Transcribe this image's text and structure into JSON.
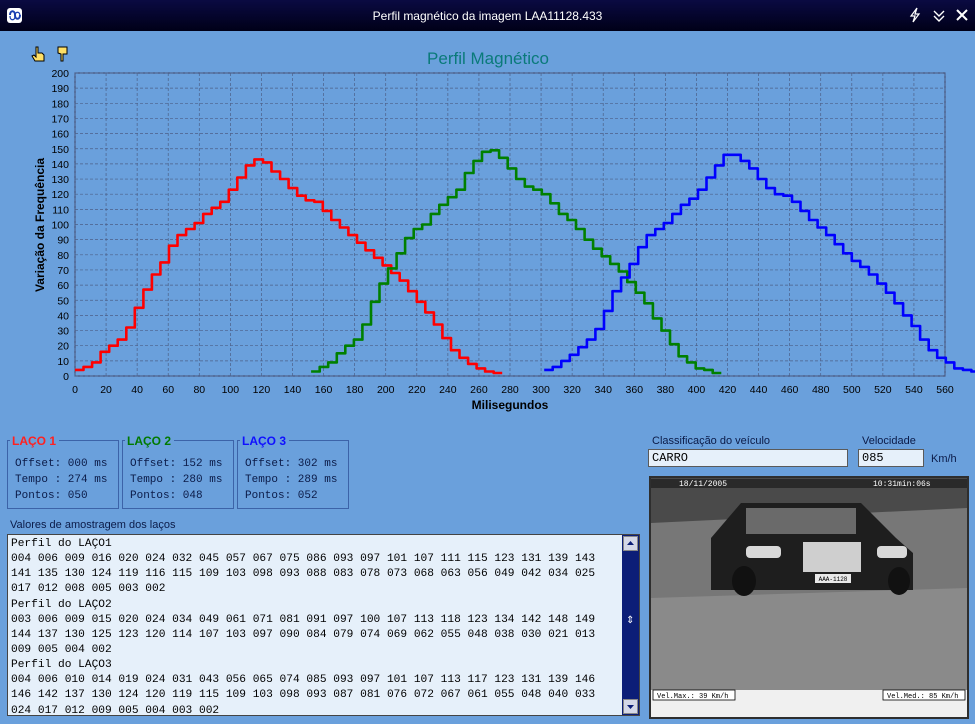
{
  "window": {
    "title": "Perfil magnético da imagem LAA11128.433",
    "controls": [
      "pin-icon",
      "minimize-icon",
      "close-icon"
    ]
  },
  "toolbar": {
    "icons": [
      "hand-pointer-icon",
      "hand-down-icon"
    ]
  },
  "chart_data": {
    "type": "line",
    "title": "Perfil Magnético",
    "xlabel": "Milisegundos",
    "ylabel": "Variação da Frequência",
    "xlim": [
      0,
      560
    ],
    "ylim": [
      0,
      200
    ],
    "xticks": [
      0,
      20,
      40,
      60,
      80,
      100,
      120,
      140,
      160,
      180,
      200,
      220,
      240,
      260,
      280,
      300,
      320,
      340,
      360,
      380,
      400,
      420,
      440,
      460,
      480,
      500,
      520,
      540,
      560
    ],
    "yticks": [
      0,
      10,
      20,
      30,
      40,
      50,
      60,
      70,
      80,
      90,
      100,
      110,
      120,
      130,
      140,
      150,
      160,
      170,
      180,
      190,
      200
    ],
    "grid": true,
    "step_ms": 5.5,
    "series": [
      {
        "color": "#ff0000",
        "x_start": 0,
        "values": [
          4,
          6,
          9,
          16,
          20,
          24,
          32,
          45,
          57,
          67,
          75,
          86,
          93,
          97,
          101,
          107,
          111,
          115,
          123,
          131,
          139,
          143,
          141,
          135,
          130,
          124,
          119,
          116,
          115,
          109,
          103,
          98,
          93,
          88,
          83,
          78,
          73,
          68,
          63,
          56,
          49,
          42,
          34,
          25,
          17,
          12,
          8,
          5,
          3,
          2
        ]
      },
      {
        "color": "#008000",
        "x_start": 152,
        "values": [
          3,
          6,
          9,
          15,
          20,
          24,
          34,
          49,
          61,
          71,
          81,
          91,
          97,
          100,
          107,
          113,
          118,
          123,
          134,
          142,
          148,
          149,
          144,
          137,
          130,
          125,
          123,
          120,
          114,
          107,
          103,
          97,
          90,
          84,
          79,
          74,
          69,
          62,
          55,
          48,
          38,
          30,
          21,
          13,
          9,
          5,
          4,
          2
        ]
      },
      {
        "color": "#0000ff",
        "x_start": 302,
        "values": [
          4,
          6,
          10,
          14,
          19,
          24,
          31,
          43,
          56,
          65,
          74,
          85,
          93,
          97,
          101,
          107,
          113,
          117,
          123,
          131,
          139,
          146,
          146,
          142,
          137,
          130,
          124,
          120,
          119,
          115,
          109,
          103,
          98,
          93,
          87,
          81,
          76,
          72,
          67,
          61,
          55,
          48,
          40,
          33,
          24,
          17,
          12,
          9,
          5,
          4,
          3,
          2
        ]
      }
    ]
  },
  "loops": [
    {
      "name": "LAÇO 1",
      "color": "#ff2020",
      "offset": "Offset: 000 ms",
      "tempo": "Tempo : 274 ms",
      "pontos": "Pontos: 050"
    },
    {
      "name": "LAÇO 2",
      "color": "#007a00",
      "offset": "Offset: 152 ms",
      "tempo": "Tempo : 280 ms",
      "pontos": "Pontos: 048"
    },
    {
      "name": "LAÇO 3",
      "color": "#1010ff",
      "offset": "Offset: 302 ms",
      "tempo": "Tempo : 289 ms",
      "pontos": "Pontos: 052"
    }
  ],
  "classification": {
    "label": "Classificação do veículo",
    "value": "CARRO"
  },
  "speed": {
    "label": "Velocidade",
    "value": "085",
    "unit": "Km/h"
  },
  "samples": {
    "label": "Valores de amostragem dos laços",
    "lines": [
      "Perfil do LAÇO1",
      "004 006 009 016 020 024 032 045 057 067 075 086 093 097 101 107 111 115 123 131 139 143",
      "141 135 130 124 119 116 115 109 103 098 093 088 083 078 073 068 063 056 049 042 034 025",
      "017 012 008 005 003 002",
      "Perfil do LAÇO2",
      "003 006 009 015 020 024 034 049 061 071 081 091 097 100 107 113 118 123 134 142 148 149",
      "144 137 130 125 123 120 114 107 103 097 090 084 079 074 069 062 055 048 038 030 021 013",
      "009 005 004 002",
      "Perfil do LAÇO3",
      "004 006 010 014 019 024 031 043 056 065 074 085 093 097 101 107 113 117 123 131 139 146",
      "146 142 137 130 124 120 119 115 109 103 098 093 087 081 076 072 067 061 055 048 040 033",
      "024 017 012 009 005 004 003 002"
    ]
  },
  "photo": {
    "date": "18/11/2005",
    "time": "10:31min:06s",
    "plate": "AAA-1128",
    "footer_left": "Vel.Max.: 39 Km/h",
    "footer_right": "Vel.Med.: 85 Km/h"
  }
}
